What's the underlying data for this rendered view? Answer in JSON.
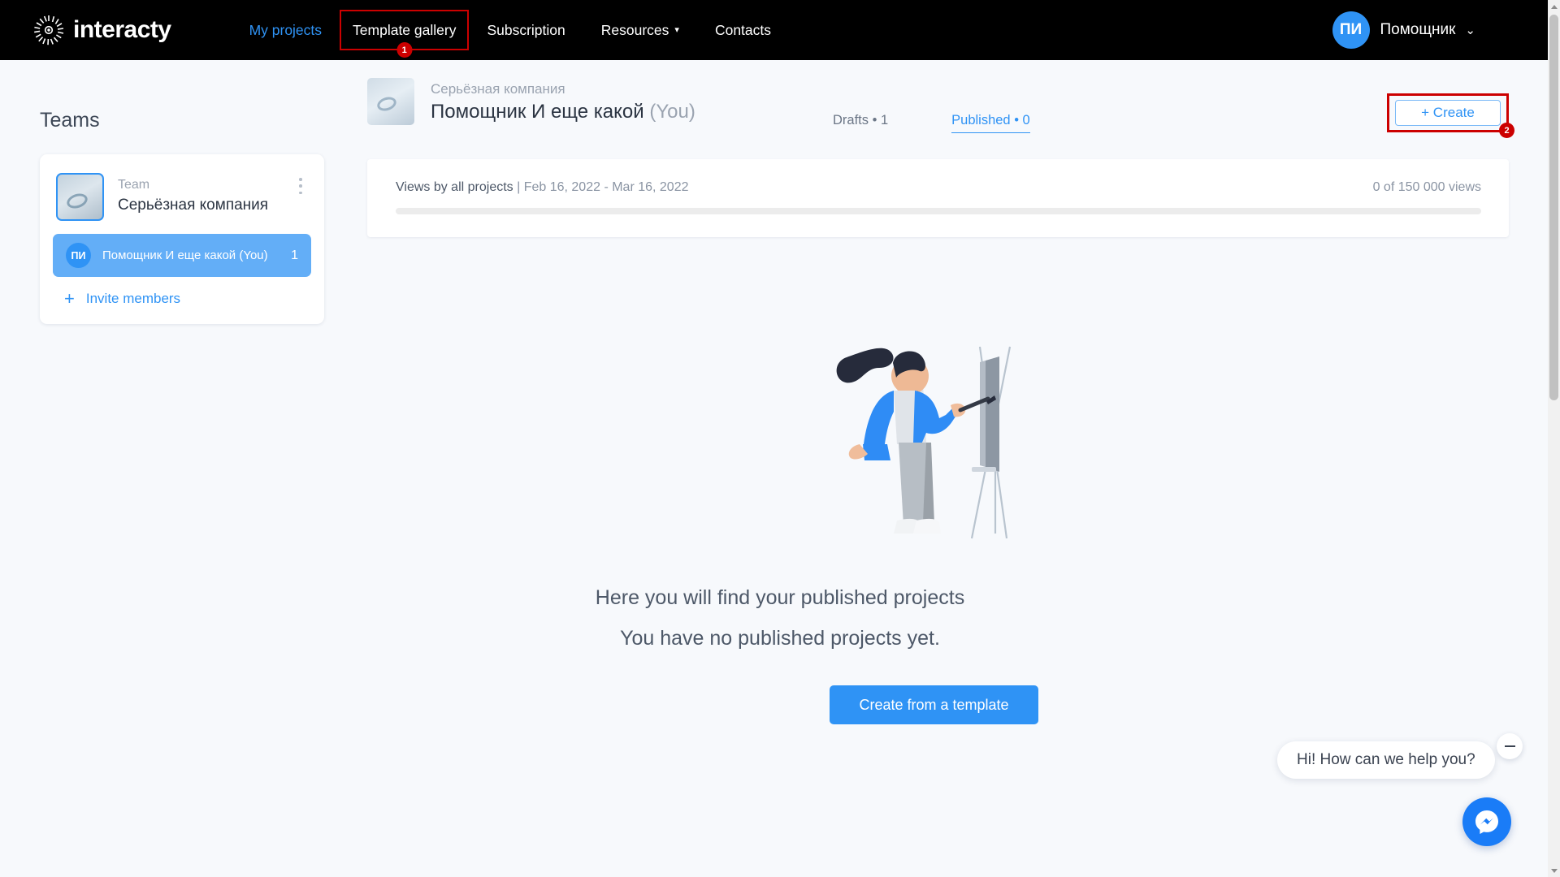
{
  "header": {
    "brand": "interacty",
    "brand_icon": "sunburst-logo-icon",
    "nav": [
      {
        "label": "My projects",
        "state": "link"
      },
      {
        "label": "Template gallery",
        "state": "highlighted",
        "badge": "1"
      },
      {
        "label": "Subscription",
        "state": "normal"
      },
      {
        "label": "Resources",
        "state": "dropdown",
        "caret": "▾"
      },
      {
        "label": "Contacts",
        "state": "normal"
      }
    ],
    "user": {
      "initials": "ПИ",
      "name": "Помощник",
      "caret": "⌄"
    }
  },
  "sidebar": {
    "title": "Teams",
    "team": {
      "label": "Team",
      "name": "Серьёзная компания",
      "menu_icon": "kebab-menu-icon"
    },
    "member": {
      "initials": "ПИ",
      "name": "Помощник И еще какой (You)",
      "count": "1"
    },
    "invite": {
      "icon": "plus-icon",
      "label": "Invite members"
    }
  },
  "project": {
    "team_name": "Серьёзная компания",
    "title": "Помощник И еще какой",
    "title_suffix": "(You)",
    "tabs": {
      "drafts": "Drafts • 1",
      "published": "Published  • 0"
    },
    "create_button": "+ Create",
    "create_badge": "2"
  },
  "views": {
    "label": "Views by all projects",
    "separator": " | ",
    "date_range": "Feb 16, 2022 - Mar 16, 2022",
    "count": "0 of 150 000 views",
    "progress_percent": 0
  },
  "empty_state": {
    "illustration": "woman-painting-at-easel-illustration",
    "line1": "Here you will find your published projects",
    "line2": "You have no published projects yet.",
    "button": "Create from a template"
  },
  "chat": {
    "message": "Hi! How can we help you?",
    "close_icon": "minimize-icon",
    "launcher_icon": "messenger-icon"
  },
  "colors": {
    "accent": "#2f93f5",
    "highlight": "#cc0000",
    "topbar": "#000000",
    "page_bg": "#f7f9fc"
  }
}
